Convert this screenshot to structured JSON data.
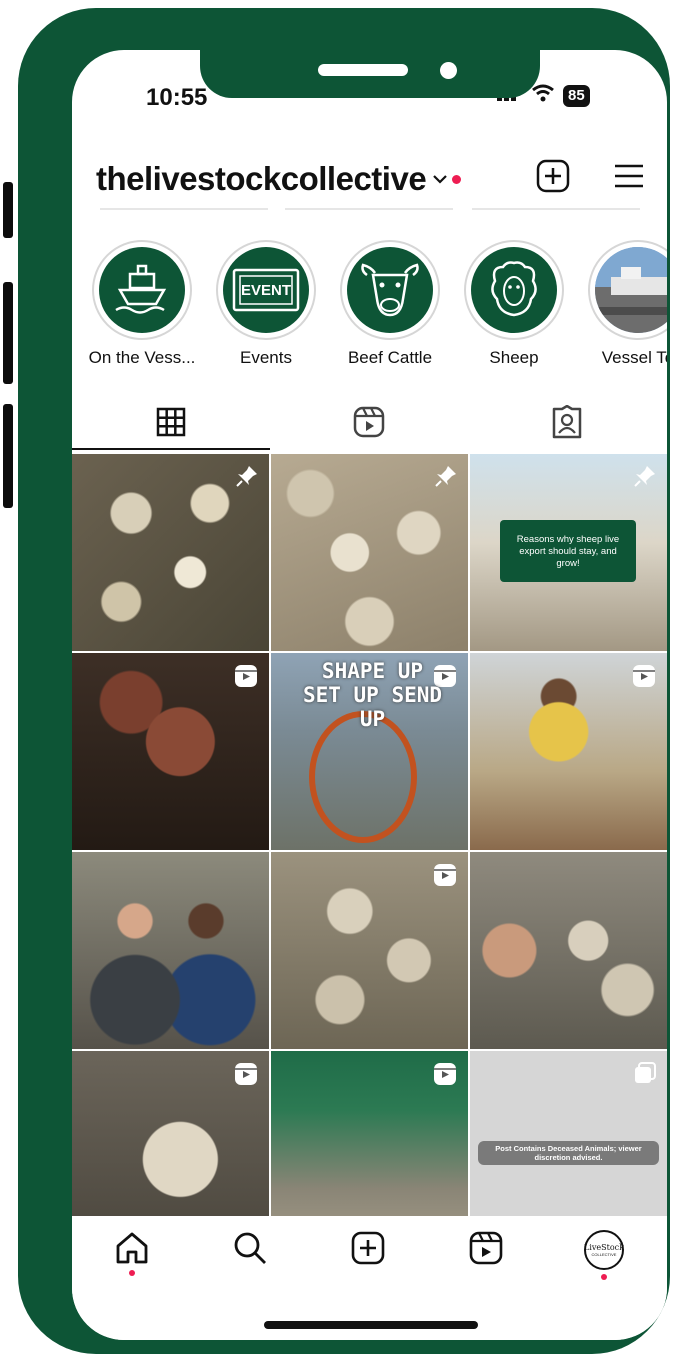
{
  "status_bar": {
    "time": "10:55",
    "battery": "85"
  },
  "profile": {
    "username": "thelivestockcollective"
  },
  "highlights": [
    {
      "label": "On the Vess...",
      "icon": "ship-icon"
    },
    {
      "label": "Events",
      "icon": "event-sign-icon"
    },
    {
      "label": "Beef Cattle",
      "icon": "cow-icon"
    },
    {
      "label": "Sheep",
      "icon": "sheep-icon"
    },
    {
      "label": "Vessel To",
      "icon": "vessel-photo"
    }
  ],
  "highlight_texts": {
    "event_sign": "EVENT"
  },
  "tabs": [
    {
      "name": "posts-grid",
      "icon": "grid-icon",
      "active": true
    },
    {
      "name": "reels",
      "icon": "reels-icon",
      "active": false
    },
    {
      "name": "tagged",
      "icon": "tagged-icon",
      "active": false
    }
  ],
  "posts": {
    "p3_caption": "Reasons why sheep live export should stay, and grow!",
    "p5_text": "SHAPE UP SET UP SEND UP",
    "p12_warning": "Post Contains Deceased Animals; viewer discretion advised."
  },
  "brand": {
    "avatar_text": "LiveStock",
    "avatar_sub": "COLLECTIVE"
  },
  "colors": {
    "brand_green": "#0d5536",
    "notification_red": "#ee1d52"
  }
}
